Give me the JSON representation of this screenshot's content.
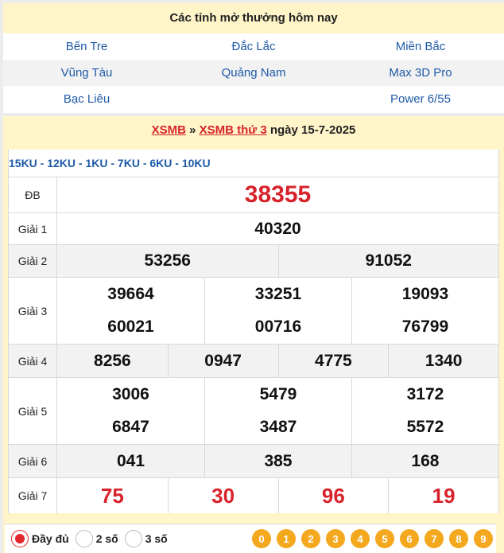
{
  "provinces": {
    "title": "Các tỉnh mở thưởng hôm nay",
    "rows": [
      [
        "Bến Tre",
        "Đắc Lắc",
        "Miền Bắc"
      ],
      [
        "Vũng Tàu",
        "Quảng Nam",
        "Max 3D Pro"
      ],
      [
        "Bạc Liêu",
        "",
        "Power 6/55"
      ]
    ]
  },
  "result": {
    "crumb_1": "XSMB",
    "sep": " » ",
    "crumb_2": "XSMB thứ 3",
    "date_text": " ngày 15-7-2025",
    "codes": "15KU - 12KU - 1KU - 7KU - 6KU - 10KU",
    "prizes": {
      "db": {
        "label": "ĐB",
        "values": [
          "38355"
        ]
      },
      "g1": {
        "label": "Giải 1",
        "values": [
          "40320"
        ]
      },
      "g2": {
        "label": "Giải 2",
        "values": [
          "53256",
          "91052"
        ]
      },
      "g3": {
        "label": "Giải 3",
        "values": [
          "39664",
          "33251",
          "19093",
          "60021",
          "00716",
          "76799"
        ]
      },
      "g4": {
        "label": "Giải 4",
        "values": [
          "8256",
          "0947",
          "4775",
          "1340"
        ]
      },
      "g5": {
        "label": "Giải 5",
        "values": [
          "3006",
          "5479",
          "3172",
          "6847",
          "3487",
          "5572"
        ]
      },
      "g6": {
        "label": "Giải 6",
        "values": [
          "041",
          "385",
          "168"
        ]
      },
      "g7": {
        "label": "Giải 7",
        "values": [
          "75",
          "30",
          "96",
          "19"
        ]
      }
    }
  },
  "controls": {
    "options": [
      "Đầy đủ",
      "2 số",
      "3 số"
    ],
    "selected": "Đầy đủ",
    "digits": [
      "0",
      "1",
      "2",
      "3",
      "4",
      "5",
      "6",
      "7",
      "8",
      "9"
    ]
  },
  "colors": {
    "accent_red": "#d8232a",
    "link_blue": "#1e5aa8",
    "header_bg": "#fff5c8",
    "digit_orange": "#f4a81d"
  }
}
